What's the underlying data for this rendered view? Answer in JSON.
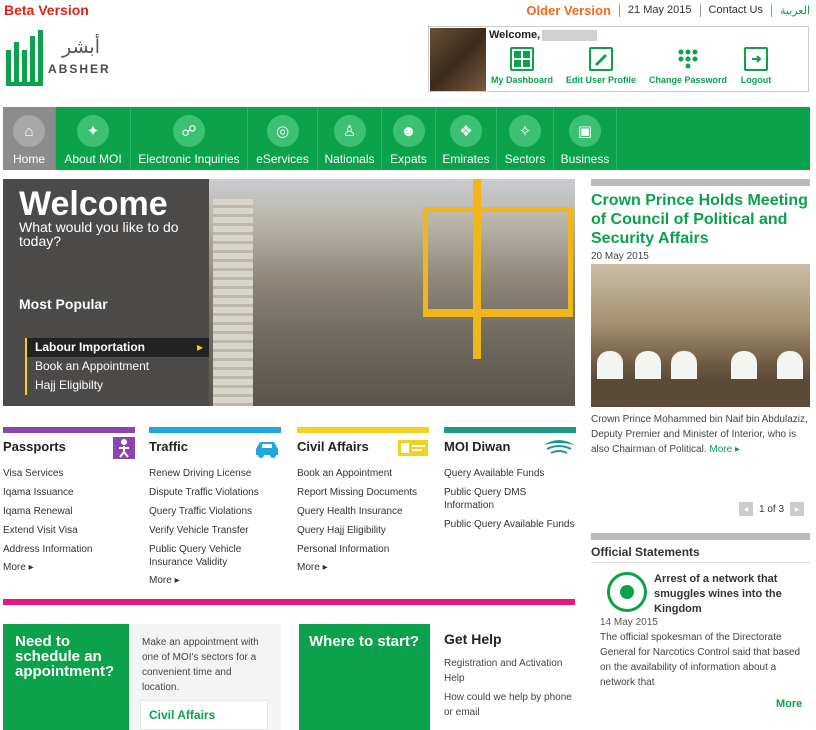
{
  "header": {
    "beta": "Beta Version",
    "older_version": "Older Version",
    "date": "21 May 2015",
    "contact": "Contact Us",
    "arabic": "العربية",
    "logo_ar": "أبشر",
    "logo_en": "ABSHER"
  },
  "user": {
    "welcome": "Welcome,",
    "actions": [
      {
        "label": "My Dashboard",
        "icon": "dashboard-icon"
      },
      {
        "label": "Edit User Profile",
        "icon": "edit-profile-icon"
      },
      {
        "label": "Change Password",
        "icon": "password-icon"
      },
      {
        "label": "Logout",
        "icon": "logout-icon"
      }
    ]
  },
  "nav": [
    {
      "label": "Home",
      "icon": "home-icon"
    },
    {
      "label": "About MOI",
      "icon": "moi-emblem-icon"
    },
    {
      "label": "Electronic Inquiries",
      "icon": "inquiries-icon"
    },
    {
      "label": "eServices",
      "icon": "globe-icon"
    },
    {
      "label": "Nationals",
      "icon": "nationals-icon"
    },
    {
      "label": "Expats",
      "icon": "expats-icon"
    },
    {
      "label": "Emirates",
      "icon": "emirates-icon"
    },
    {
      "label": "Sectors",
      "icon": "sectors-icon"
    },
    {
      "label": "Business",
      "icon": "briefcase-icon"
    }
  ],
  "hero": {
    "title": "Welcome",
    "subtitle": "What would you like to do today?",
    "most_popular": "Most Popular",
    "popular": [
      "Labour Importation",
      "Book an Appointment",
      "Hajj Eligibilty"
    ]
  },
  "news": {
    "title": "Crown Prince Holds Meeting of Council of Political and Security Affairs",
    "date": "20 May 2015",
    "body": "Crown Prince Mohammed bin Naif bin Abdulaziz, Deputy Premier and Minister of Interior, who is also Chairman of Political.",
    "more": "More",
    "page": "1",
    "of": "of",
    "total": "3"
  },
  "services": [
    {
      "title": "Passports",
      "color": "#8e44ad",
      "icon": "passport-person-icon",
      "links": [
        "Visa Services",
        "Iqama Issuance",
        "Iqama Renewal",
        "Extend Visit Visa",
        "Address Information"
      ],
      "more": "More"
    },
    {
      "title": "Traffic",
      "color": "#1ea7e1",
      "icon": "car-icon",
      "links": [
        "Renew Driving License",
        "Dispute Traffic Violations",
        "Query Traffic Violations",
        "Verify Vehicle Transfer",
        "Public Query Vehicle Insurance Validity"
      ],
      "more": "More"
    },
    {
      "title": "Civil Affairs",
      "color": "#f2d21c",
      "icon": "id-card-icon",
      "links": [
        "Book an Appointment",
        "Report Missing Documents",
        "Query Health Insurance",
        "Query Hajj Eligibility",
        "Personal Information"
      ],
      "more": "More"
    },
    {
      "title": "MOI Diwan",
      "color": "#1a9a8a",
      "icon": "diwan-emblem-icon",
      "links": [
        "Query Available Funds",
        "Public Query DMS Information",
        "Public Query Available Funds"
      ],
      "more": ""
    }
  ],
  "statements": {
    "heading": "Official Statements",
    "title": "Arrest of a network that smuggles wines into the Kingdom",
    "date": "14 May 2015",
    "body": "The official spokesman of the Directorate General for Narcotics Control said that based on the availability of information about a network that",
    "more": "More"
  },
  "bottom": {
    "appt_heading": "Need to schedule an appointment?",
    "appt_text": "Make an appointment with one of MOI's sectors for a convenient time and location.",
    "civil_affairs": "Civil Affairs",
    "where_heading": "Where to start?",
    "help_heading": "Get Help",
    "help_links": [
      "Registration and Activation Help",
      "How could we help by phone or email"
    ]
  }
}
